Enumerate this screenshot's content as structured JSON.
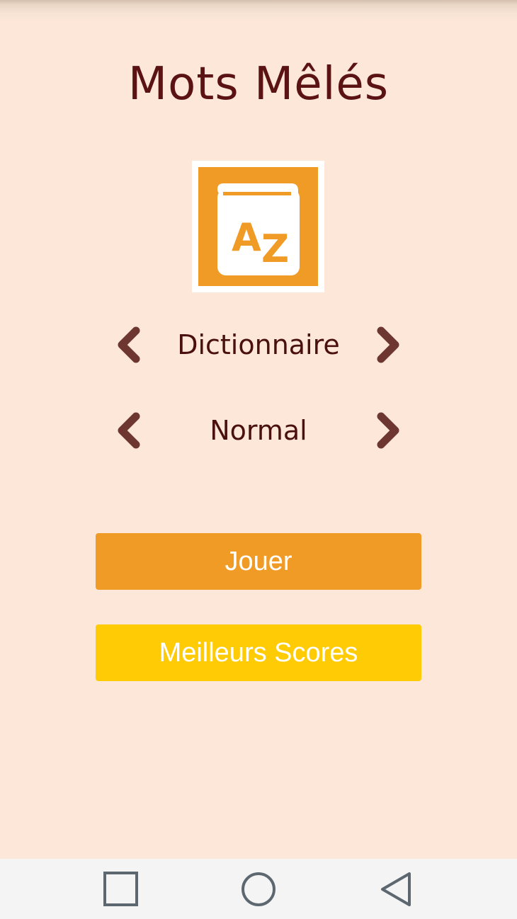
{
  "app": {
    "title": "Mots Mêlés",
    "logo_icon": "dictionary-az-book-icon"
  },
  "selectors": [
    {
      "name": "category",
      "value": "Dictionnaire",
      "prev_icon": "chevron-left-icon",
      "next_icon": "chevron-right-icon"
    },
    {
      "name": "difficulty",
      "value": "Normal",
      "prev_icon": "chevron-left-icon",
      "next_icon": "chevron-right-icon"
    }
  ],
  "buttons": {
    "play_label": "Jouer",
    "scores_label": "Meilleurs Scores"
  },
  "navbar": {
    "items": [
      "recent-apps",
      "home",
      "back"
    ]
  },
  "colors": {
    "background": "#fce7d8",
    "title": "#5a1212",
    "arrow": "#6e3630",
    "play_button": "#f09b26",
    "scores_button": "#fecb05",
    "logo_orange": "#f09b26",
    "navbar_bg": "#f4f4f4",
    "navbar_icon": "#5d6770"
  }
}
